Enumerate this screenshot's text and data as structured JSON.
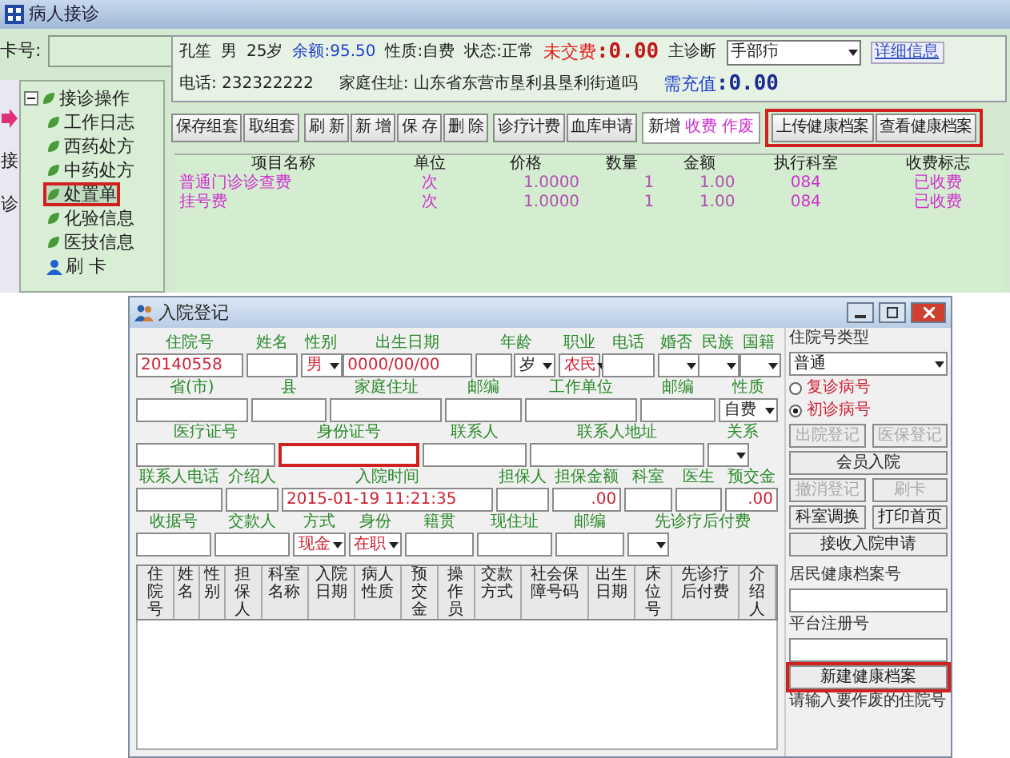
{
  "reception_window": {
    "title": "病人接诊",
    "card": {
      "label": "卡号:"
    },
    "side_strip": [
      "接",
      "诊"
    ],
    "tree": [
      {
        "label": "接诊操作",
        "expanded": true,
        "selected": false,
        "highlighted": false,
        "kind": "leaf",
        "children": [
          {
            "label": "工作日志",
            "selected": false,
            "highlighted": false,
            "kind": "leaf"
          },
          {
            "label": "西药处方",
            "selected": false,
            "highlighted": false,
            "kind": "leaf"
          },
          {
            "label": "中药处方",
            "selected": false,
            "highlighted": false,
            "kind": "leaf"
          },
          {
            "label": "处置单",
            "selected": true,
            "highlighted": true,
            "kind": "leaf"
          },
          {
            "label": "化验信息",
            "selected": false,
            "highlighted": false,
            "kind": "leaf"
          },
          {
            "label": "医技信息",
            "selected": false,
            "highlighted": false,
            "kind": "leaf"
          },
          {
            "label": "刷 卡",
            "selected": false,
            "highlighted": false,
            "kind": "user"
          }
        ]
      }
    ],
    "patient": {
      "name": "孔笙",
      "sex": "男",
      "age": "25岁",
      "balance": "余额:95.50",
      "nature": "性质:自费",
      "status": "状态:正常",
      "unpaid_label": "未交费",
      "unpaid": ":0.00",
      "diagnosis_label": "主诊断",
      "diagnosis": "手部疖",
      "details_button": "详细信息",
      "phone": "电话: 232322222",
      "address": "家庭住址: 山东省东营市垦利县垦利街道吗",
      "recharge_label": "需充值",
      "recharge": ":0.00"
    },
    "toolbar_groups": [
      {
        "framed": false,
        "highlighted": false,
        "items": [
          {
            "label": "保存组套",
            "kind": "button"
          },
          {
            "label": "取组套",
            "kind": "button"
          }
        ]
      },
      {
        "framed": false,
        "highlighted": false,
        "items": [
          {
            "label": "刷 新",
            "kind": "button"
          },
          {
            "label": "新 增",
            "kind": "button"
          },
          {
            "label": "保 存",
            "kind": "button"
          },
          {
            "label": "删 除",
            "kind": "button"
          }
        ]
      },
      {
        "framed": false,
        "highlighted": false,
        "items": [
          {
            "label": "诊疗计费",
            "kind": "button"
          },
          {
            "label": "血库申请",
            "kind": "button"
          }
        ]
      },
      {
        "framed": true,
        "highlighted": false,
        "items": [
          {
            "label": "新增",
            "kind": "tag",
            "color": "#202020"
          },
          {
            "label": "收费",
            "kind": "tag",
            "color": "#d030d0"
          },
          {
            "label": "作废",
            "kind": "tag",
            "color": "#d030d0"
          }
        ]
      },
      {
        "framed": false,
        "highlighted": true,
        "items": [
          {
            "label": "上传健康档案",
            "kind": "button"
          },
          {
            "label": "查看健康档案",
            "kind": "button"
          }
        ]
      }
    ],
    "table": {
      "columns": [
        "项目名称",
        "单位",
        "价格",
        "数量",
        "金额",
        "执行科室",
        "收费标志"
      ],
      "rows": [
        [
          "普通门诊诊查费",
          "次",
          "1.0000",
          "1",
          "1.00",
          "084",
          "已收费"
        ],
        [
          "挂号费",
          "次",
          "1.0000",
          "1",
          "1.00",
          "084",
          "已收费"
        ]
      ]
    }
  },
  "admission_window": {
    "title": "入院登记",
    "form_rows": [
      {
        "fields": [
          {
            "label": "住院号",
            "inputs": [
              {
                "kind": "text",
                "value": "20140558",
                "color": "#d02030"
              }
            ]
          },
          {
            "label": "姓名",
            "inputs": [
              {
                "kind": "text"
              }
            ]
          },
          {
            "label": "性别",
            "inputs": [
              {
                "kind": "select",
                "value": "男",
                "color": "#d02030"
              }
            ]
          },
          {
            "label": "出生日期",
            "inputs": [
              {
                "kind": "text",
                "value": "0000/00/00",
                "color": "#d02030"
              }
            ]
          },
          {
            "label": "年龄",
            "inputs": [
              {
                "kind": "text"
              },
              {
                "kind": "select",
                "value": "岁",
                "color": "#202020"
              }
            ]
          },
          {
            "label": "职业",
            "inputs": [
              {
                "kind": "select",
                "value": "农民",
                "color": "#d02030"
              }
            ]
          },
          {
            "label": "电话",
            "inputs": [
              {
                "kind": "text"
              }
            ]
          },
          {
            "label": "婚否",
            "inputs": [
              {
                "kind": "select"
              }
            ]
          },
          {
            "label": "民族",
            "inputs": [
              {
                "kind": "select"
              }
            ]
          },
          {
            "label": "国籍",
            "inputs": [
              {
                "kind": "select"
              }
            ]
          }
        ]
      },
      {
        "fields": [
          {
            "label": "省(市)",
            "inputs": [
              {
                "kind": "text"
              }
            ]
          },
          {
            "label": "县",
            "inputs": [
              {
                "kind": "text"
              }
            ]
          },
          {
            "label": "家庭住址",
            "inputs": [
              {
                "kind": "text"
              }
            ]
          },
          {
            "label": "邮编",
            "inputs": [
              {
                "kind": "text"
              }
            ]
          },
          {
            "label": "工作单位",
            "inputs": [
              {
                "kind": "text"
              }
            ]
          },
          {
            "label": "邮编",
            "inputs": [
              {
                "kind": "text"
              }
            ]
          },
          {
            "label": "性质",
            "inputs": [
              {
                "kind": "select",
                "value": "自费",
                "color": "#202020"
              }
            ]
          }
        ]
      },
      {
        "fields": [
          {
            "label": "医疗证号",
            "inputs": [
              {
                "kind": "text"
              }
            ]
          },
          {
            "label": "身份证号",
            "highlighted": true,
            "inputs": [
              {
                "kind": "text"
              }
            ]
          },
          {
            "label": "联系人",
            "inputs": [
              {
                "kind": "text"
              }
            ]
          },
          {
            "label": "联系人地址",
            "inputs": [
              {
                "kind": "text"
              }
            ]
          },
          {
            "label": "关系",
            "inputs": [
              {
                "kind": "select"
              }
            ]
          }
        ]
      },
      {
        "fields": [
          {
            "label": "联系人电话",
            "inputs": [
              {
                "kind": "text"
              }
            ]
          },
          {
            "label": "介绍人",
            "inputs": [
              {
                "kind": "text"
              }
            ]
          },
          {
            "label": "入院时间",
            "inputs": [
              {
                "kind": "text",
                "value": "2015-01-19 11:21:35",
                "color": "#d02030"
              }
            ]
          },
          {
            "label": "担保人",
            "inputs": [
              {
                "kind": "text"
              }
            ]
          },
          {
            "label": "担保金额",
            "inputs": [
              {
                "kind": "text",
                "value": ".00",
                "color": "#d02030"
              }
            ]
          },
          {
            "label": "科室",
            "inputs": [
              {
                "kind": "text"
              }
            ]
          },
          {
            "label": "医生",
            "inputs": [
              {
                "kind": "text"
              }
            ]
          },
          {
            "label": "预交金",
            "inputs": [
              {
                "kind": "text",
                "value": ".00",
                "color": "#d02030"
              }
            ]
          }
        ]
      },
      {
        "fields": [
          {
            "label": "收据号",
            "inputs": [
              {
                "kind": "text"
              }
            ]
          },
          {
            "label": "交款人",
            "inputs": [
              {
                "kind": "text"
              }
            ]
          },
          {
            "label": "方式",
            "inputs": [
              {
                "kind": "select",
                "value": "现金",
                "color": "#d02030"
              }
            ]
          },
          {
            "label": "身份",
            "inputs": [
              {
                "kind": "select",
                "value": "在职",
                "color": "#d02030"
              }
            ]
          },
          {
            "label": "籍贯",
            "inputs": [
              {
                "kind": "text"
              }
            ]
          },
          {
            "label": "现住址",
            "inputs": [
              {
                "kind": "text"
              }
            ]
          },
          {
            "label": "邮编",
            "inputs": [
              {
                "kind": "text"
              }
            ]
          },
          {
            "label": "先诊疗后付费",
            "inputs": [
              {
                "kind": "select"
              }
            ]
          }
        ]
      }
    ],
    "list_columns": [
      "住院号",
      "姓名",
      "性别",
      "担保人",
      "科室名称",
      "入院日期",
      "病人性质",
      "预交金",
      "操作员",
      "交款方式",
      "社会保障号码",
      "出生日期",
      "床位号",
      "先诊疗后付费",
      "介绍人"
    ],
    "side": {
      "type_label": "住院号类型",
      "type_value": "普通",
      "radios": [
        {
          "label": "复诊病号",
          "selected": false
        },
        {
          "label": "初诊病号",
          "selected": true
        }
      ],
      "button_rows": [
        [
          {
            "label": "出院登记",
            "disabled": true
          },
          {
            "label": "医保登记",
            "disabled": true
          }
        ],
        [
          {
            "label": "会员入院",
            "disabled": false
          }
        ],
        [
          {
            "label": "撤消登记",
            "disabled": true
          },
          {
            "label": "刷卡",
            "disabled": true
          }
        ],
        [
          {
            "label": "科室调换",
            "disabled": false
          },
          {
            "label": "打印首页",
            "disabled": false
          }
        ],
        [
          {
            "label": "接收入院申请",
            "disabled": false
          }
        ]
      ],
      "health_label": "居民健康档案号",
      "platform_label": "平台注册号",
      "create_button": {
        "label": "新建健康档案",
        "highlighted": true
      },
      "void_label": "请输入要作废的住院号"
    }
  }
}
